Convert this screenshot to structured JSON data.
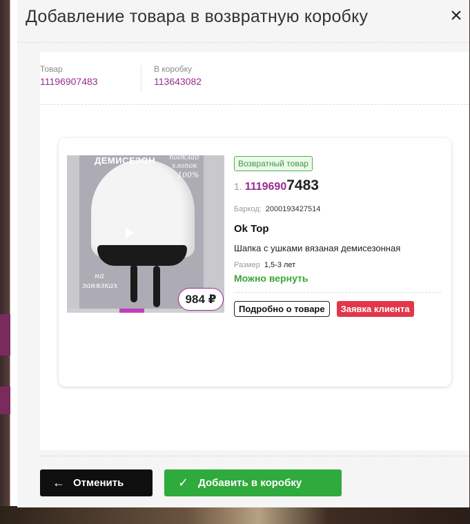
{
  "modal": {
    "title": "Добавление товара в возвратную коробку",
    "close_icon": "×"
  },
  "ids": {
    "product_label": "Товар",
    "product_value": "11196907483",
    "box_label": "В коробку",
    "box_value": "113643082"
  },
  "product": {
    "image_title": "ДЕМИСЕЗОН",
    "image_note_1": "подклад",
    "image_note_2": "хлопок",
    "image_note_3": "100%",
    "image_note_bottom_1": "на",
    "image_note_bottom_2": "завязках",
    "price": "984 ₽",
    "return_badge": "Возвратный товар",
    "index": "1.",
    "article_part1": "1119690",
    "article_part2": "7483",
    "barcode_label": "Баркод:",
    "barcode_value": "2000193427514",
    "brand": "Ok Top",
    "name": "Шапка с ушками вязаная демисезонная",
    "size_label": "Размер",
    "size_value": "1,5-3 лет",
    "returnable": "Можно вернуть",
    "details_button": "Подробно о товаре",
    "client_request_button": "Заявка клиента"
  },
  "footer": {
    "cancel_label": "Отменить",
    "cancel_icon": "arrow-left-icon",
    "add_label": "Добавить в коробку",
    "add_icon": "check-icon"
  },
  "colors": {
    "accent_purple": "#9b2b92",
    "green": "#2faa3c",
    "red": "#e0384a"
  }
}
